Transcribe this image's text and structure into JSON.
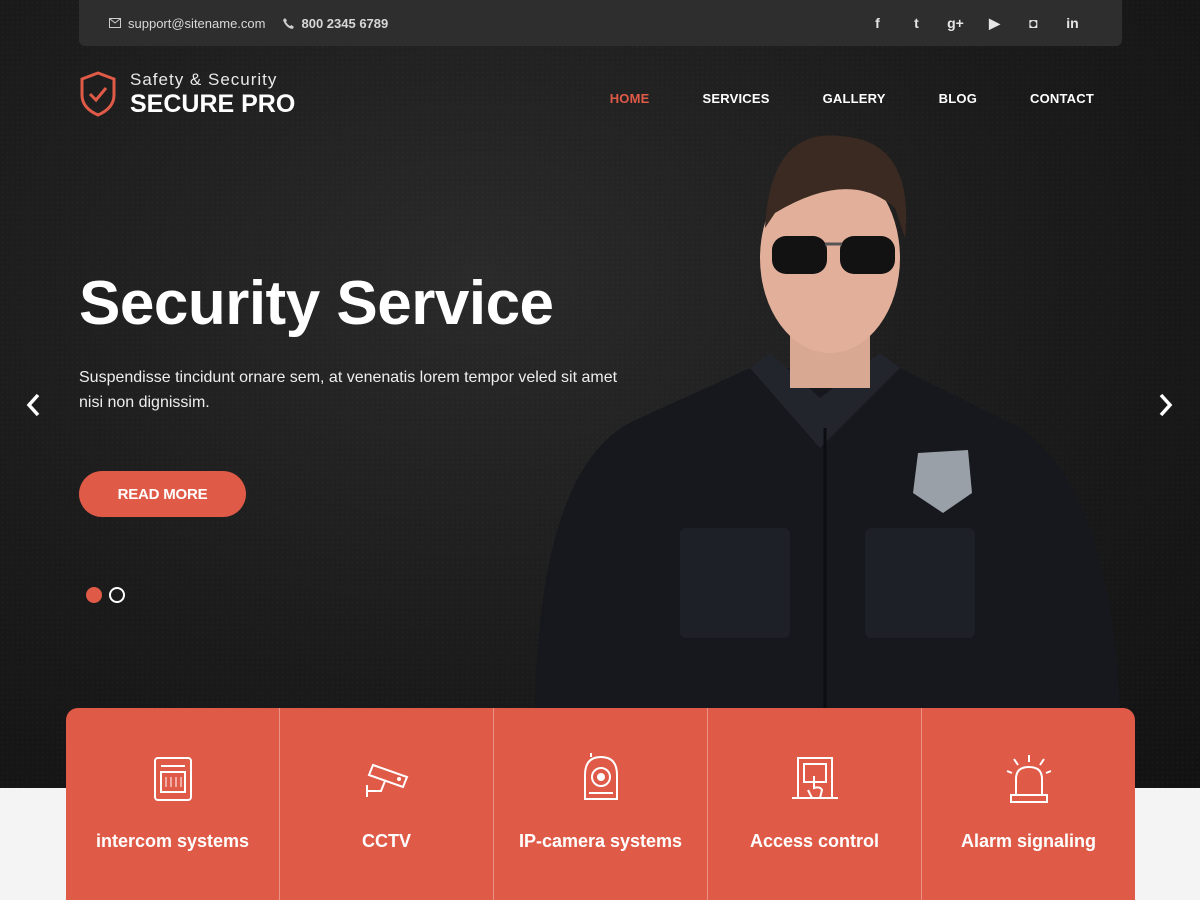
{
  "topbar": {
    "email": "support@sitename.com",
    "phone": "800 2345 6789",
    "social": [
      {
        "icon": "facebook-icon",
        "glyph": "f"
      },
      {
        "icon": "twitter-icon",
        "glyph": "t"
      },
      {
        "icon": "google-plus-icon",
        "glyph": "g+"
      },
      {
        "icon": "youtube-icon",
        "glyph": "▶"
      },
      {
        "icon": "instagram-icon",
        "glyph": "◘"
      },
      {
        "icon": "linkedin-icon",
        "glyph": "in"
      }
    ]
  },
  "logo": {
    "tagline": "Safety & Security",
    "name": "SECURE PRO"
  },
  "nav": {
    "items": [
      "HOME",
      "SERVICES",
      "GALLERY",
      "BLOG",
      "CONTACT"
    ],
    "active": "HOME"
  },
  "hero": {
    "title": "Security Service",
    "subtitle": "Suspendisse tincidunt ornare sem, at venenatis lorem tempor veled sit amet nisi non dignissim.",
    "button": "READ MORE"
  },
  "features": [
    {
      "label": "intercom systems",
      "icon": "intercom-icon"
    },
    {
      "label": "CCTV",
      "icon": "cctv-camera-icon"
    },
    {
      "label": "IP-camera systems",
      "icon": "ip-camera-icon"
    },
    {
      "label": "Access control",
      "icon": "access-control-icon"
    },
    {
      "label": "Alarm signaling",
      "icon": "alarm-siren-icon"
    }
  ],
  "colors": {
    "accent": "#e05a48",
    "dark": "#1b1b1b"
  }
}
